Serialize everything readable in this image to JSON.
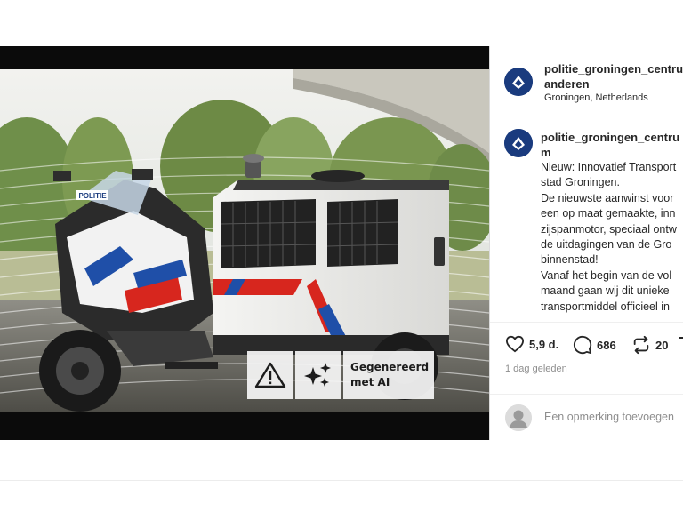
{
  "post": {
    "image_alt": "Police motorcycle with sidecar transport unit",
    "photo_text": {
      "windshield_label": "POLITIE"
    },
    "ai_badge": {
      "warning_icon": "warning-triangle-icon",
      "sparkle_icon": "sparkles-icon",
      "label": "Gegenereerd\nmet AI"
    }
  },
  "header": {
    "username_line1": "politie_groningen_centru",
    "username_line2": "anderen",
    "location": "Groningen, Netherlands"
  },
  "caption": {
    "username_line1": "politie_groningen_centru",
    "username_line2": "m",
    "lines": [
      "Nieuw: Innovatief Transport",
      "stad Groningen.",
      "De nieuwste aanwinst voor",
      "een op maat gemaakte, inn",
      "zijspanmotor, speciaal ontw",
      "de uitdagingen van de Gro",
      "binnenstad!",
      "Vanaf het begin van de vol",
      "maand gaan wij dit unieke",
      "transportmiddel officieel in"
    ]
  },
  "actions": {
    "likes": "5,9 d.",
    "comments": "686",
    "reposts": "20",
    "timestamp": "1 dag geleden"
  },
  "comment_box": {
    "placeholder": "Een opmerking toevoegen"
  },
  "colors": {
    "police_blue": "#1a3b7e",
    "police_red": "#d7261e",
    "police_stripe_blue": "#1f4fa8"
  }
}
